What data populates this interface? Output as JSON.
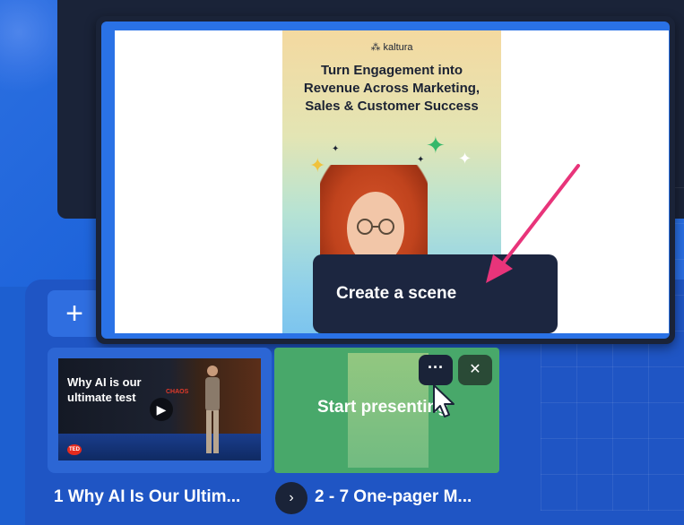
{
  "add_button": {
    "label": "+"
  },
  "preview": {
    "poster": {
      "logo": "⁂ kaltura",
      "headline_line1": "Turn Engagement into",
      "headline_line2": "Revenue Across Marketing,",
      "headline_line3": "Sales & Customer Success"
    },
    "tooltip": "Create a scene"
  },
  "scenes": [
    {
      "thumb_title": "Why AI is our ultimate test",
      "thumb_tag": "CHAOS",
      "badge": "TED",
      "play_icon": "play-icon",
      "label": "1 Why AI Is Our Ultim..."
    },
    {
      "overlay_text": "Start presenting",
      "more_button": "···",
      "close_button": "✕",
      "label": "2 - 7 One-pager M..."
    }
  ],
  "nav": {
    "next_button": "›"
  },
  "colors": {
    "background": "#1d5fd0",
    "dark_panel": "#1a2338",
    "tooltip_bg": "#1c2640",
    "arrow": "#e8347a",
    "selected_scene": "#48a86a"
  }
}
